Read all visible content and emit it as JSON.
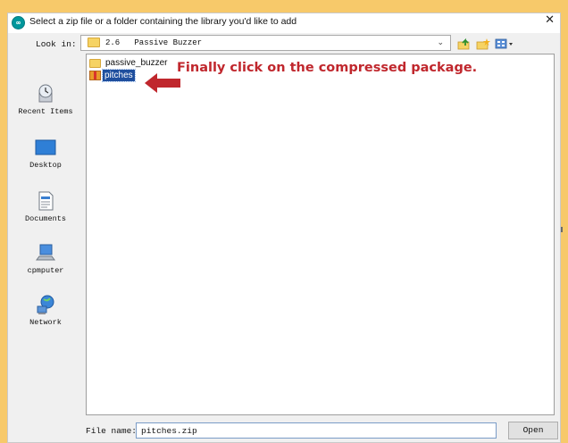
{
  "window": {
    "title": "Select a zip file or a folder containing the library you'd like to add",
    "close_glyph": "✕"
  },
  "look_in": {
    "label": "Look in:",
    "value": "2.6   Passive Buzzer",
    "dropdown_glyph": "⌄"
  },
  "toolbar": {
    "up_icon": "up-one-level-icon",
    "new_folder_icon": "new-folder-icon",
    "view_menu_icon": "view-menu-icon"
  },
  "sidebar": {
    "items": [
      {
        "label": "Recent Items",
        "icon": "recent-items-icon"
      },
      {
        "label": "Desktop",
        "icon": "desktop-icon"
      },
      {
        "label": "Documents",
        "icon": "documents-icon"
      },
      {
        "label": "cpmputer",
        "icon": "computer-icon"
      },
      {
        "label": "Network",
        "icon": "network-icon"
      }
    ]
  },
  "files": [
    {
      "name": "passive_buzzer",
      "type": "folder",
      "selected": false
    },
    {
      "name": "pitches",
      "type": "zip",
      "selected": true
    }
  ],
  "annotation": {
    "text": "Finally click on the compressed package.",
    "color": "#c0272d"
  },
  "file_name": {
    "label": "File name:",
    "value": "pitches.zip"
  },
  "buttons": {
    "open": "Open"
  },
  "colors": {
    "page_background": "#f7c96a",
    "selection": "#1f4f9e"
  }
}
